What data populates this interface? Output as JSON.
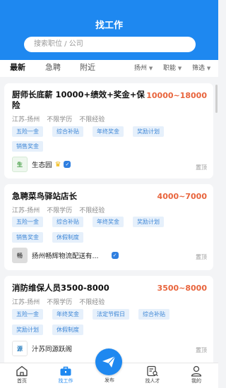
{
  "header": {
    "title": "找工作"
  },
  "search": {
    "placeholder": "搜索职位 / 公司"
  },
  "tabs": [
    "最新",
    "急聘",
    "附近"
  ],
  "filters": [
    "扬州",
    "职能",
    "筛选"
  ],
  "jobs": [
    {
      "title_line1": "厨师长底薪 10000+绩效+奖金+保",
      "title_line2": "险",
      "salary": "10000~18000",
      "reqs": [
        "江苏-扬州",
        "不限学历",
        "不限经验"
      ],
      "tags": [
        "五险一金",
        "综合补贴",
        "年终奖金",
        "奖励计划",
        "销售奖金"
      ],
      "company": "生态园",
      "pin": "置顶"
    },
    {
      "title_line1": "急聘菜鸟驿站店长",
      "salary": "4000~7000",
      "reqs": [
        "江苏-扬州",
        "不限学历",
        "不限经验"
      ],
      "tags": [
        "五险一金",
        "综合补贴",
        "年终奖金",
        "奖励计划",
        "销售奖金",
        "休假制度"
      ],
      "company": "扬州畅辉物流配送有...",
      "pin": "置顶"
    },
    {
      "title_line1": "消防维保人员3500-8000",
      "salary": "3500~8000",
      "reqs": [
        "江苏-扬州",
        "不限学历",
        "不限经验"
      ],
      "tags": [
        "五险一金",
        "年终奖金",
        "法定节假日",
        "综合补贴",
        "奖励计划",
        "休假制度"
      ],
      "company": "汁苏同源跃阁",
      "pin": "置顶"
    }
  ],
  "tabbar": [
    "首页",
    "找工作",
    "发布",
    "找人才",
    "我的"
  ],
  "colors": {
    "primary": "#1e88f0",
    "salary": "#e8643c",
    "tag_bg": "#e6f0fb",
    "tag_text": "#3d86d6"
  }
}
